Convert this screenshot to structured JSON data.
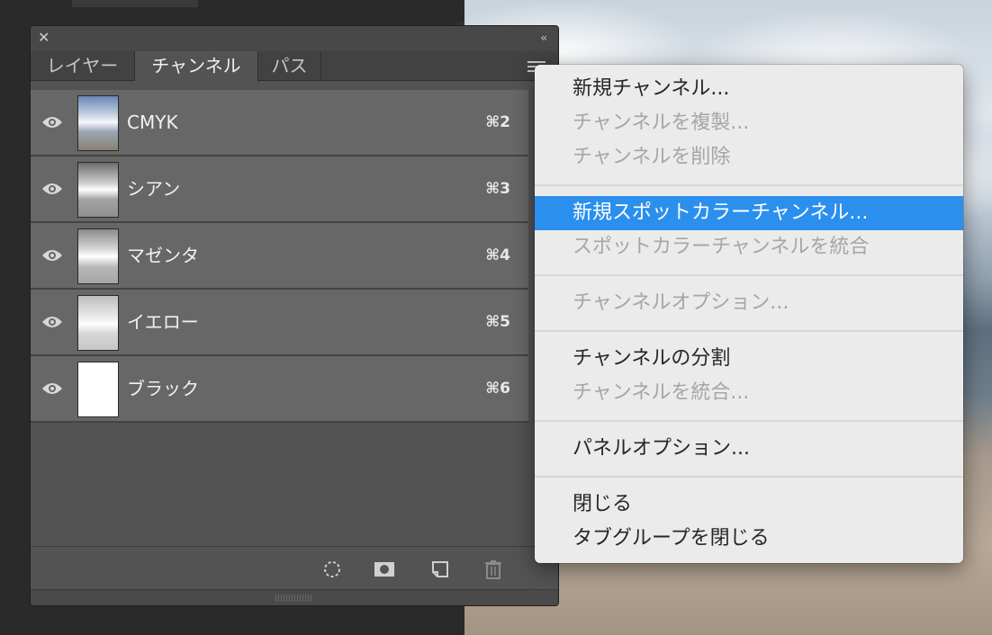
{
  "panel": {
    "tabs": [
      {
        "label": "レイヤー",
        "active": false
      },
      {
        "label": "チャンネル",
        "active": true
      },
      {
        "label": "パス",
        "active": false
      }
    ],
    "channels": [
      {
        "name": "CMYK",
        "shortcut": "⌘2"
      },
      {
        "name": "シアン",
        "shortcut": "⌘3"
      },
      {
        "name": "マゼンタ",
        "shortcut": "⌘4"
      },
      {
        "name": "イエロー",
        "shortcut": "⌘5"
      },
      {
        "name": "ブラック",
        "shortcut": "⌘6"
      }
    ],
    "icons": {
      "close": "close-icon",
      "collapse": "double-chevron-left-icon",
      "menu": "hamburger-menu-icon",
      "visibility": "eye-icon",
      "load_selection": "dashed-selection-icon",
      "save_selection": "mask-icon",
      "new_channel": "new-channel-icon",
      "delete": "trash-icon"
    }
  },
  "menu": {
    "items": [
      {
        "label": "新規チャンネル...",
        "disabled": false,
        "highlighted": false
      },
      {
        "label": "チャンネルを複製...",
        "disabled": true,
        "highlighted": false
      },
      {
        "label": "チャンネルを削除",
        "disabled": true,
        "highlighted": false
      },
      {
        "separator": true
      },
      {
        "label": "新規スポットカラーチャンネル...",
        "disabled": false,
        "highlighted": true
      },
      {
        "label": "スポットカラーチャンネルを統合",
        "disabled": true,
        "highlighted": false
      },
      {
        "separator": true
      },
      {
        "label": "チャンネルオプション...",
        "disabled": true,
        "highlighted": false
      },
      {
        "separator": true
      },
      {
        "label": "チャンネルの分割",
        "disabled": false,
        "highlighted": false
      },
      {
        "label": "チャンネルを統合...",
        "disabled": true,
        "highlighted": false
      },
      {
        "separator": true
      },
      {
        "label": "パネルオプション...",
        "disabled": false,
        "highlighted": false
      },
      {
        "separator": true
      },
      {
        "label": "閉じる",
        "disabled": false,
        "highlighted": false
      },
      {
        "label": "タブグループを閉じる",
        "disabled": false,
        "highlighted": false
      }
    ]
  },
  "colors": {
    "highlight": "#2b8fed",
    "panel_bg": "#535353",
    "row_bg": "#676767"
  }
}
